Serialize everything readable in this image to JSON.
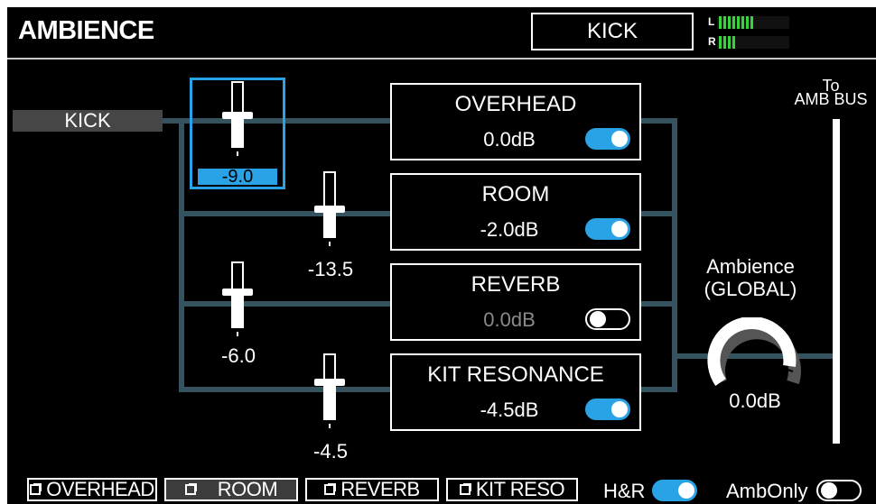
{
  "header": {
    "title": "AMBIENCE",
    "instrument": "KICK",
    "meter": {
      "left_label": "L",
      "right_label": "R",
      "left_level": 0.3,
      "right_level": 0.15,
      "color": "#38d23a"
    }
  },
  "source": {
    "label": "KICK"
  },
  "send_faders": {
    "overhead": {
      "value": "-9.0",
      "level": 0.55,
      "selected": true
    },
    "room": {
      "value": "-13.5",
      "level": 0.45
    },
    "reverb": {
      "value": "-6.0",
      "level": 0.6
    },
    "kit_resonance": {
      "value": "-4.5",
      "level": 0.65
    }
  },
  "buses": [
    {
      "name": "OVERHEAD",
      "level": "0.0dB",
      "enabled": true
    },
    {
      "name": "ROOM",
      "level": "-2.0dB",
      "enabled": true
    },
    {
      "name": "REVERB",
      "level": "0.0dB",
      "enabled": false
    },
    {
      "name": "KIT RESONANCE",
      "level": "-4.5dB",
      "enabled": true
    }
  ],
  "output": {
    "to_label_line1": "To",
    "to_label_line2": "AMB BUS",
    "global_label_line1": "Ambience",
    "global_label_line2": "(GLOBAL)",
    "global_value": "0.0dB",
    "knob_level": 0.8
  },
  "footer": {
    "overhead": "OVERHEAD",
    "room": "ROOM",
    "reverb": "REVERB",
    "kit_reso": "KIT RESO",
    "hr_label": "H&R",
    "hr_on": true,
    "amb_only_label": "AmbOnly",
    "amb_only_on": false
  },
  "colors": {
    "accent": "#2aa2e6",
    "wire": "#35525f",
    "meter": "#38d23a"
  }
}
